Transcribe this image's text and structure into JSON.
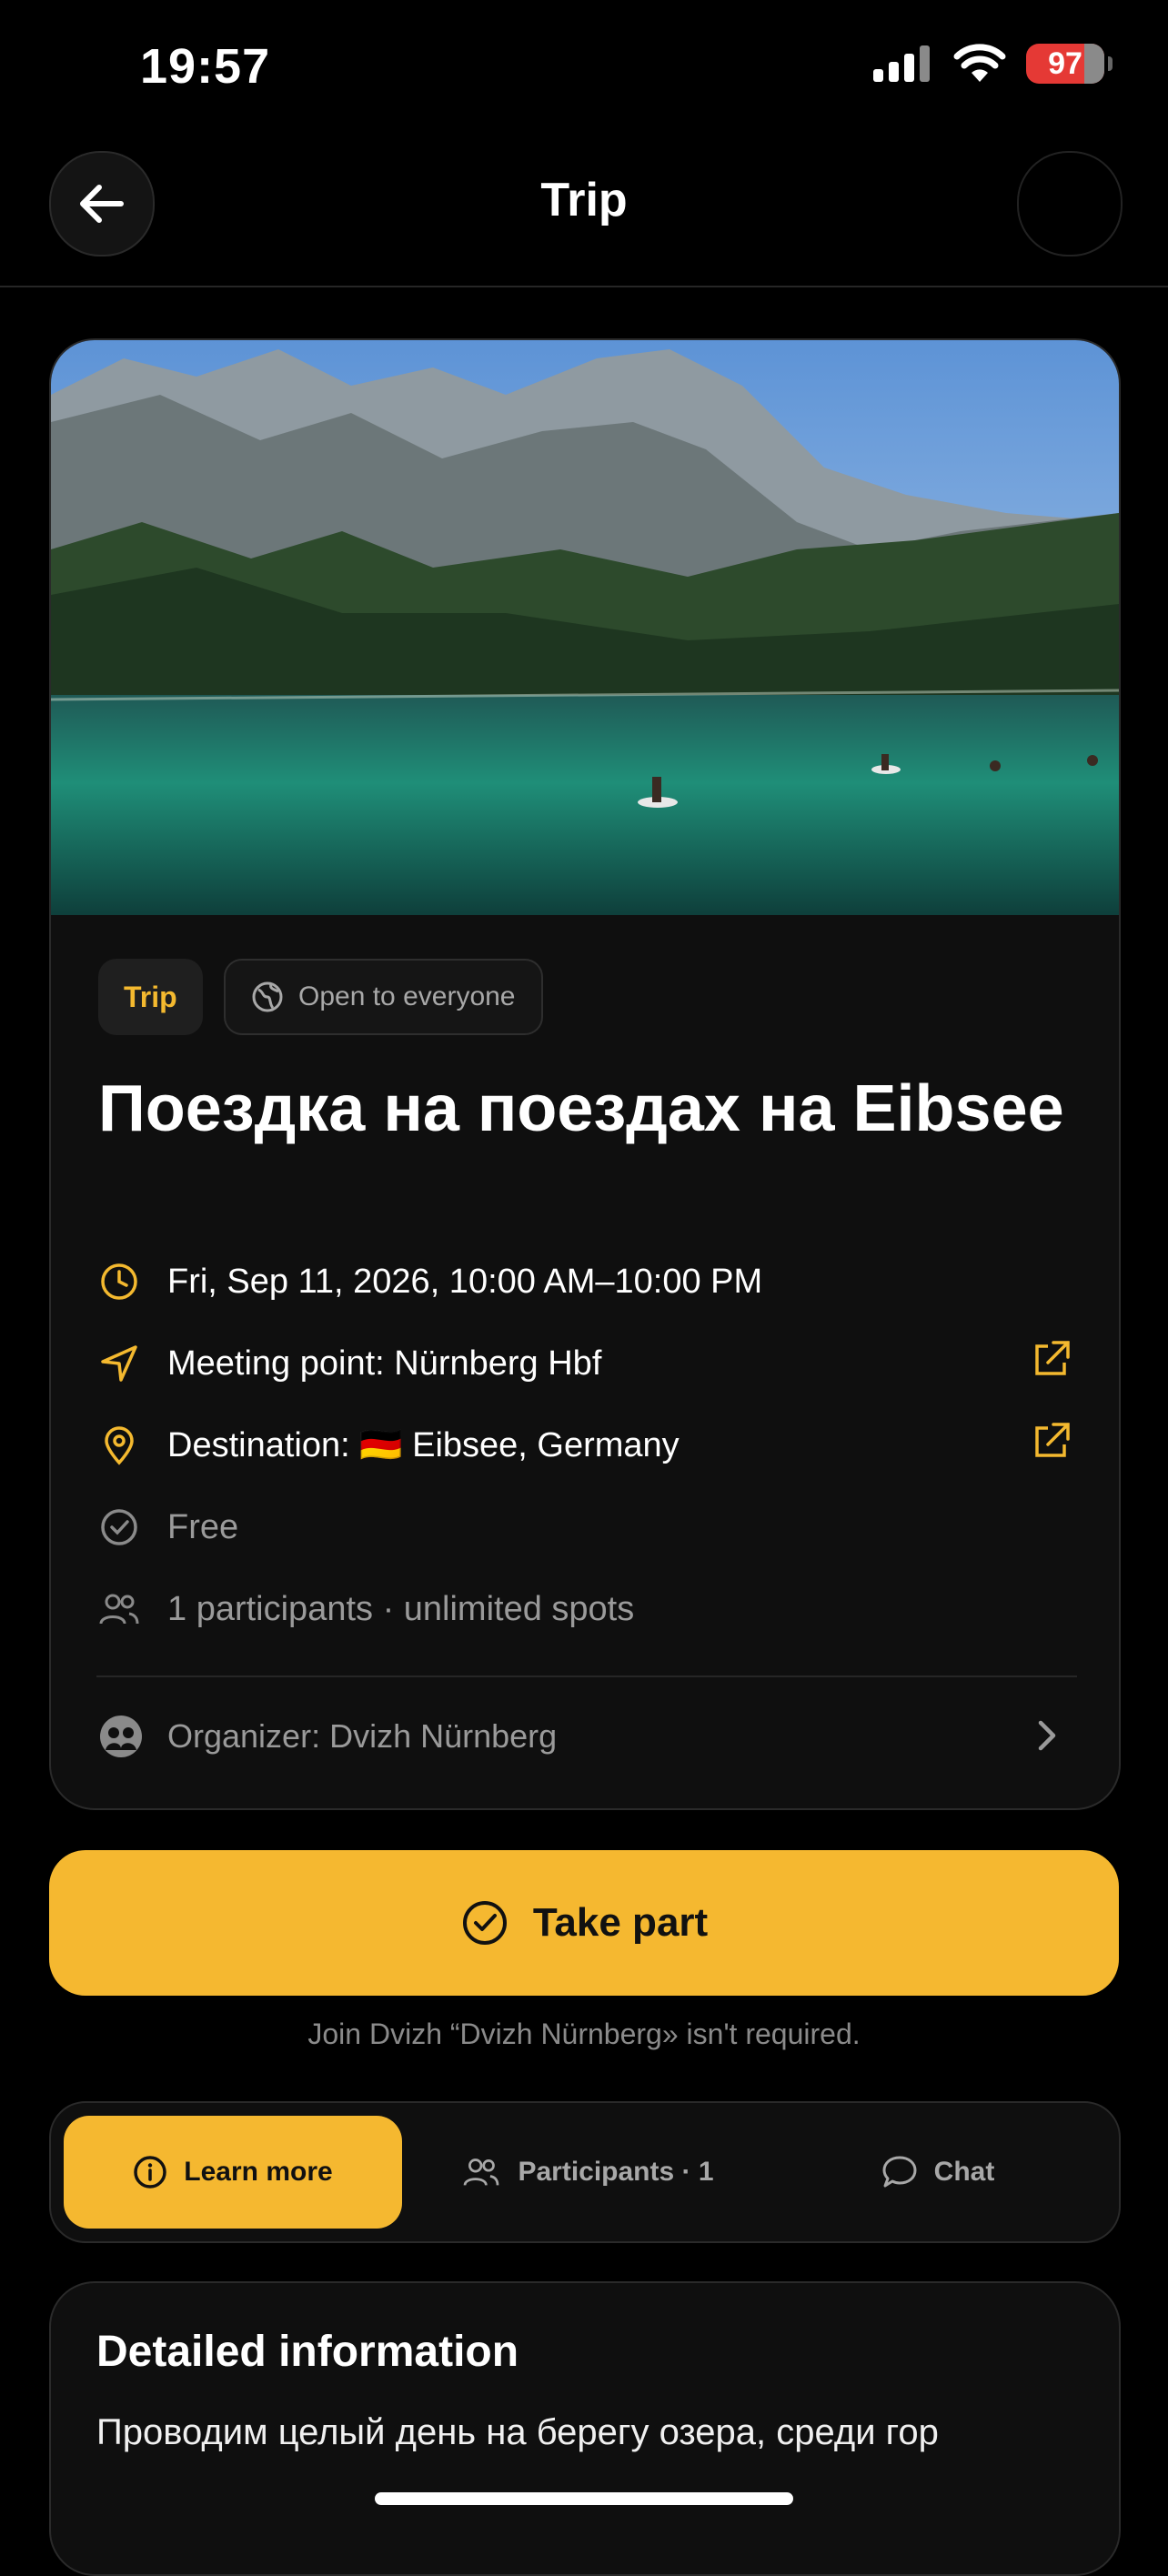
{
  "status": {
    "time": "19:57",
    "battery": "97"
  },
  "nav": {
    "title": "Trip"
  },
  "event": {
    "badge_type": "Trip",
    "badge_visibility": "Open to everyone",
    "title": "Поездка на поездах на Eibsee",
    "datetime": "Fri, Sep 11, 2026, 10:00 AM–10:00 PM",
    "meeting_point": "Meeting point: Nürnberg Hbf",
    "destination": "Destination: 🇩🇪 Eibsee, Germany",
    "price": "Free",
    "participants": "1 participants · unlimited spots",
    "organizer": "Organizer: Dvizh Nürnberg"
  },
  "actions": {
    "take_part": "Take part",
    "join_note": "Join Dvizh “Dvizh Nürnberg» isn't required."
  },
  "tabs": {
    "learn_more": "Learn more",
    "participants": "Participants · 1",
    "chat": "Chat"
  },
  "details": {
    "title": "Detailed information",
    "text": "Проводим целый день на берегу озера, среди гор"
  },
  "colors": {
    "accent": "#f5b830",
    "background": "#000000",
    "card": "#0f0f0f"
  }
}
